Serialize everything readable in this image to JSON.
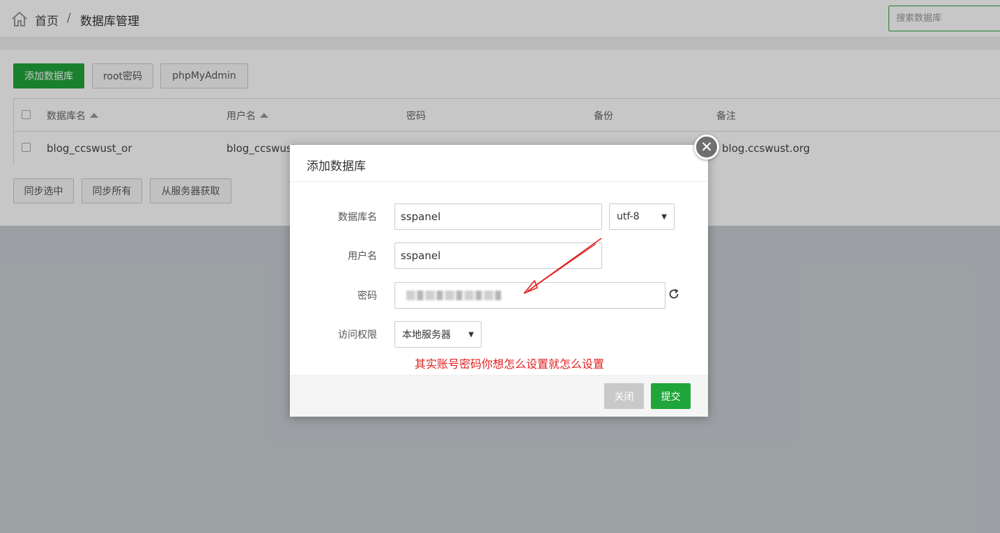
{
  "header": {
    "home_label": "首页",
    "separator": "/",
    "current_label": "数据库管理",
    "search_placeholder": "搜索数据库"
  },
  "toolbar": {
    "add_label": "添加数据库",
    "root_label": "root密码",
    "phpmyadmin_label": "phpMyAdmin"
  },
  "table": {
    "columns": [
      "数据库名",
      "用户名",
      "密码",
      "备份",
      "备注"
    ],
    "rows": [
      {
        "name": "blog_ccswust_or",
        "user": "blog_ccswust",
        "note": "blog.ccswust.org"
      }
    ]
  },
  "bottom_actions": {
    "sync_selected": "同步选中",
    "sync_all": "同步所有",
    "fetch_server": "从服务器获取"
  },
  "modal": {
    "title": "添加数据库",
    "close_glyph": "✕",
    "labels": {
      "db_name": "数据库名",
      "username": "用户名",
      "password": "密码",
      "access": "访问权限"
    },
    "values": {
      "db_name": "sspanel",
      "charset": "utf-8",
      "username": "sspanel",
      "access": "本地服务器"
    },
    "note": "其实账号密码你想怎么设置就怎么设置",
    "buttons": {
      "close": "关闭",
      "submit": "提交"
    }
  },
  "colors": {
    "brand_green": "#20a53a",
    "annotation_red": "#e02020"
  },
  "icons": {
    "home": "home-icon",
    "refresh": "refresh-icon",
    "close": "close-icon",
    "sort": "sort-up-icon"
  }
}
